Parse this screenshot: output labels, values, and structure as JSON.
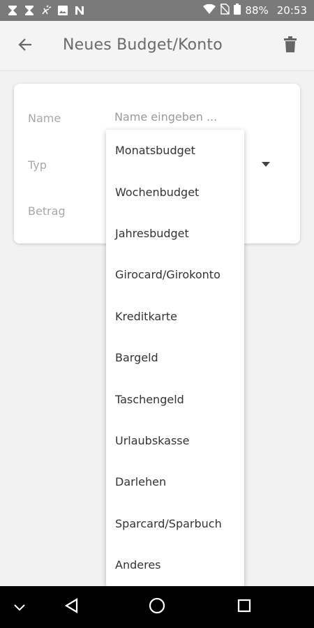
{
  "status_bar": {
    "battery_percent": "88%",
    "time": "20:53",
    "icons": [
      "hourglass-icon",
      "hourglass-icon",
      "bug-icon",
      "image-icon",
      "n-icon",
      "wifi-icon",
      "no-sim-icon",
      "battery-icon"
    ]
  },
  "app_bar": {
    "title": "Neues Budget/Konto",
    "back_icon": "arrow-left-icon",
    "delete_icon": "trash-icon"
  },
  "form": {
    "name_label": "Name",
    "name_placeholder": "Name eingeben ...",
    "type_label": "Typ",
    "amount_label": "Betrag"
  },
  "type_dropdown": {
    "options": [
      "Monatsbudget",
      "Wochenbudget",
      "Jahresbudget",
      "Girocard/Girokonto",
      "Kreditkarte",
      "Bargeld",
      "Taschengeld",
      "Urlaubskasse",
      "Darlehen",
      "Sparcard/Sparbuch",
      "Anderes"
    ]
  },
  "nav_bar": {
    "icons": [
      "chevron-down-icon",
      "back-triangle-icon",
      "home-circle-icon",
      "recents-square-icon"
    ]
  },
  "colors": {
    "status_bar_bg": "#7a7a7a",
    "app_bar_bg": "#f4f4f4",
    "page_bg": "#f2f2f2",
    "nav_bar_bg": "#000000"
  }
}
